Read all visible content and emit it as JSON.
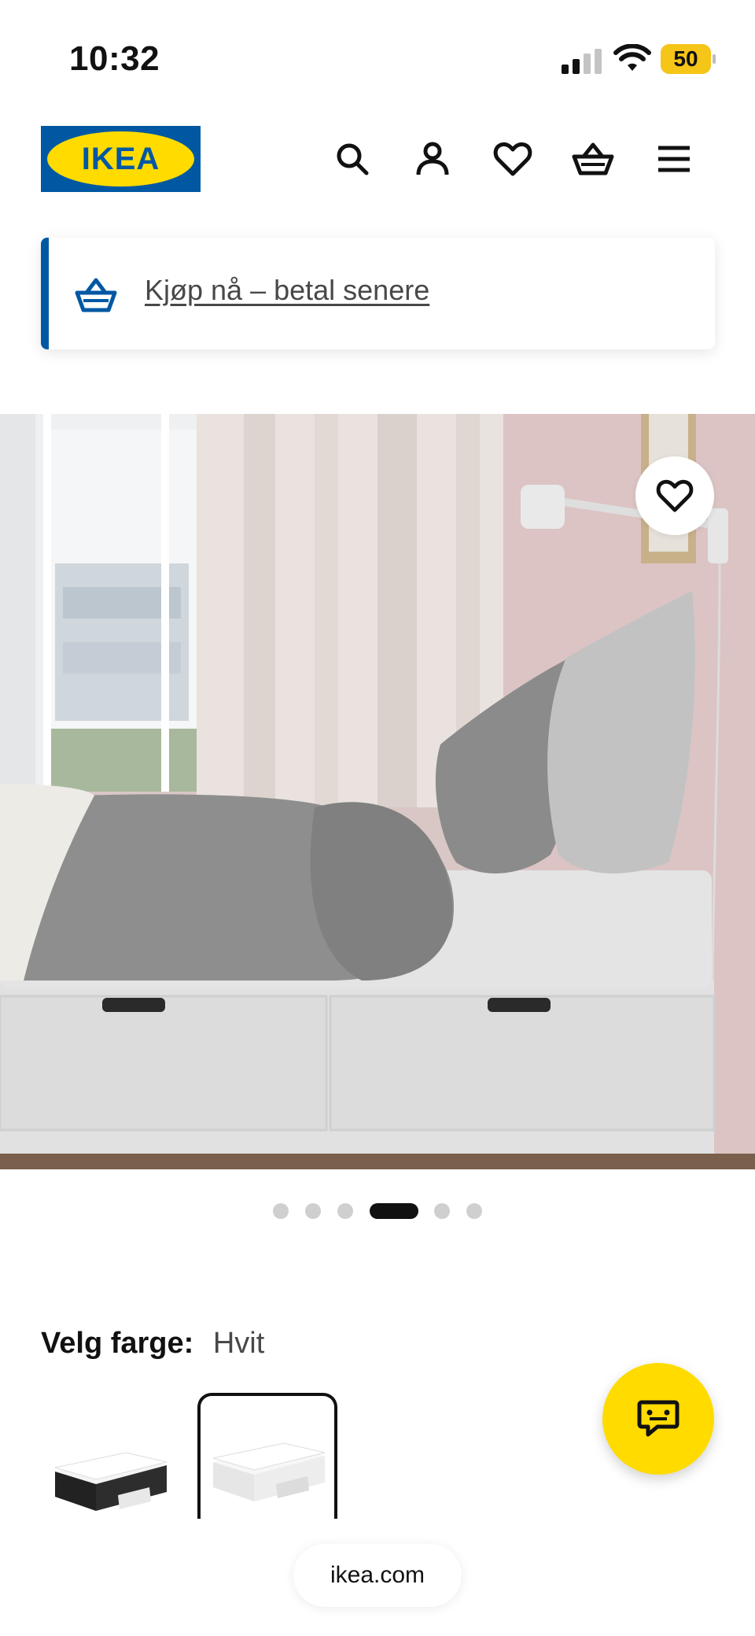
{
  "status_bar": {
    "time": "10:32",
    "battery_level": "50",
    "battery_color": "#f5c518"
  },
  "header": {
    "logo_text": "IKEA",
    "icons": [
      "search-icon",
      "user-icon",
      "heart-icon",
      "basket-icon",
      "menu-icon"
    ]
  },
  "promo": {
    "text": "Kjøp nå – betal senere",
    "icon": "basket-icon",
    "accent": "#0058a3"
  },
  "gallery": {
    "total_images": 6,
    "active_index": 3
  },
  "color_picker": {
    "label": "Velg farge:",
    "selected_value": "Hvit",
    "options": [
      "black-bed-swatch",
      "white-bed-swatch"
    ]
  },
  "chat": {
    "icon": "chat-icon",
    "color": "#ffdb00"
  },
  "browser": {
    "url": "ikea.com"
  },
  "colors": {
    "ikea_blue": "#0058a3",
    "ikea_yellow": "#ffdb00"
  }
}
